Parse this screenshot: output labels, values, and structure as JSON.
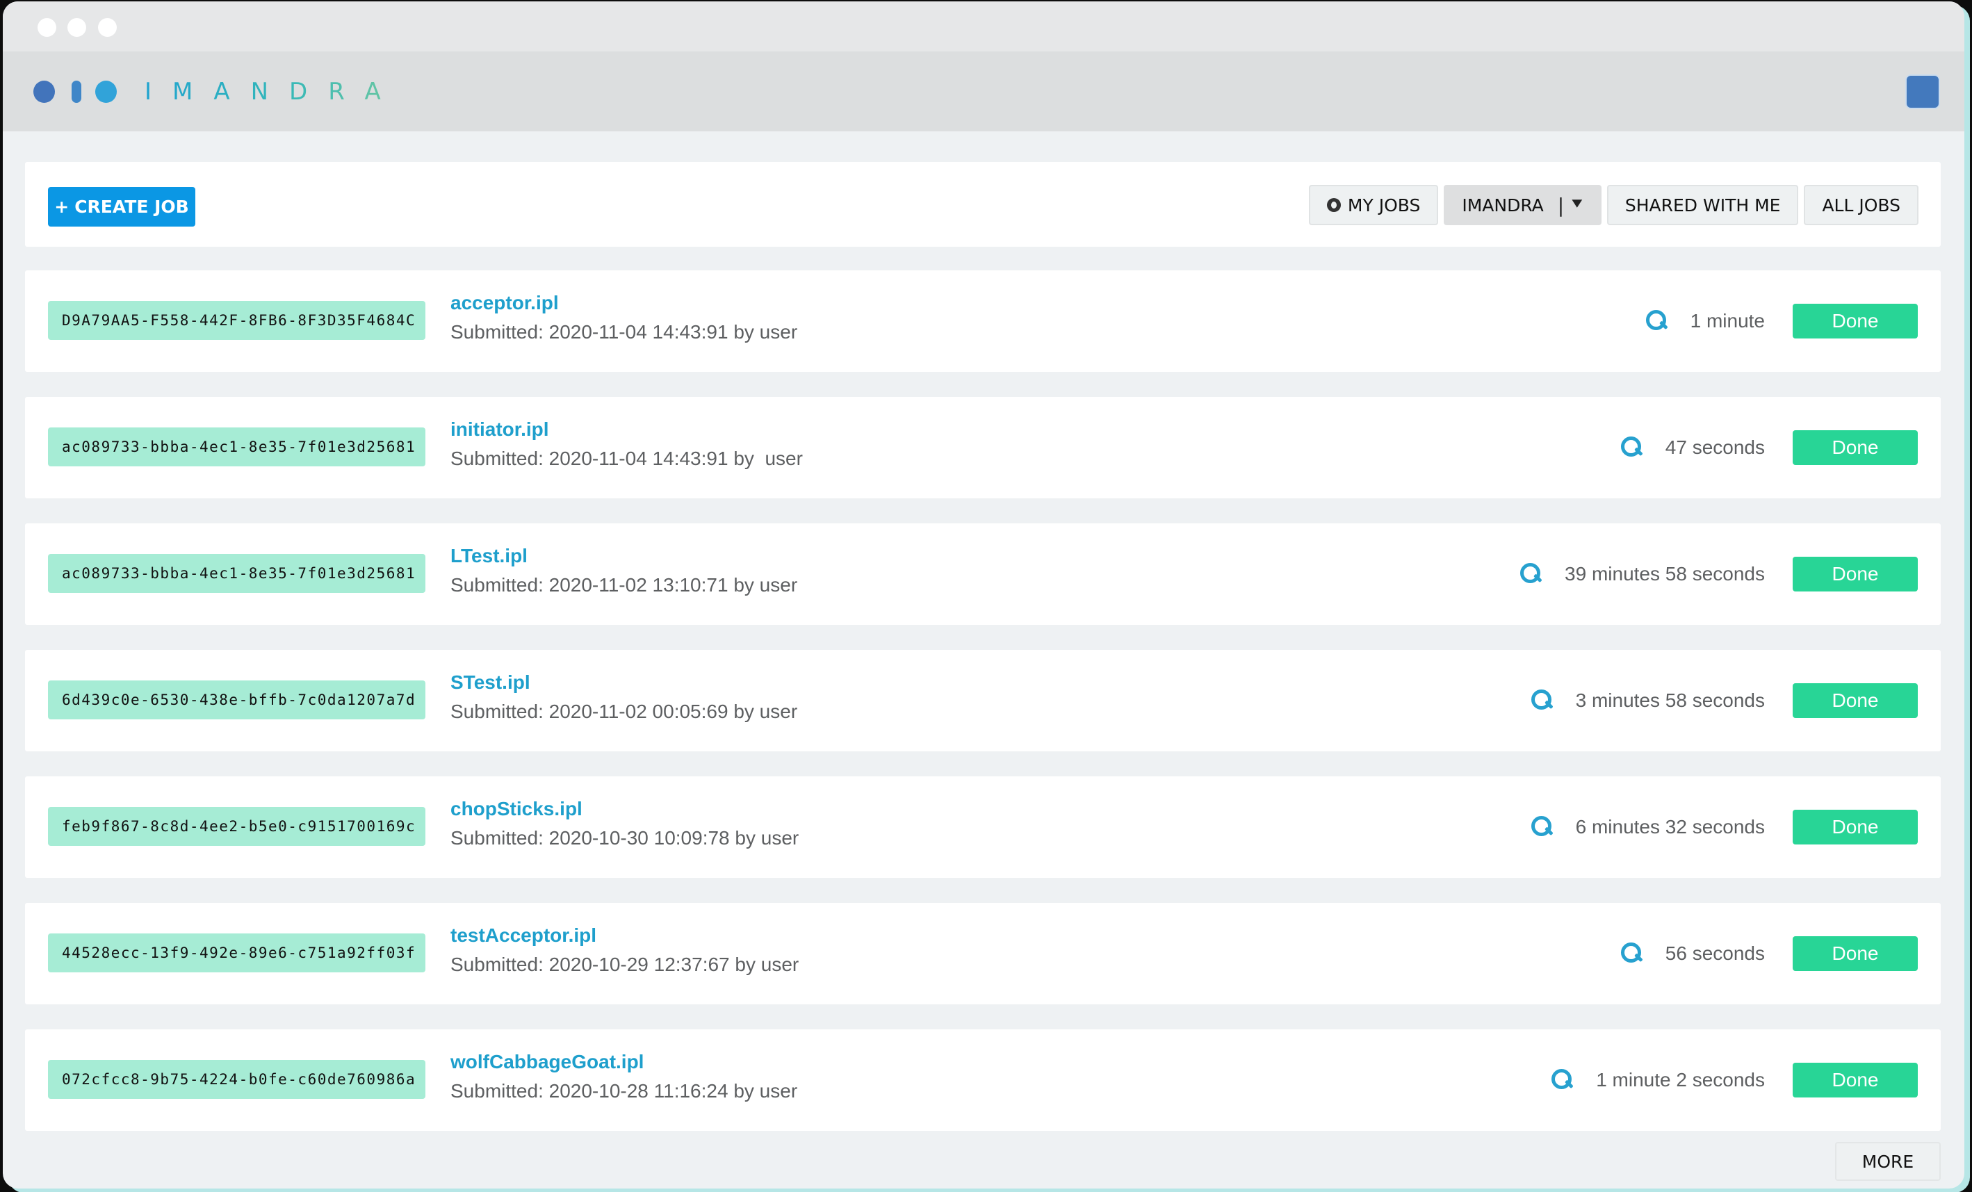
{
  "window": {
    "controls": [
      "close",
      "minimize",
      "maximize"
    ]
  },
  "app": {
    "brand": "IMANDRA",
    "user_avatar_color": "#4379bd"
  },
  "toolbar": {
    "create_job_icon": "+",
    "create_job_label": "CREATE JOB",
    "filters": {
      "my_jobs": {
        "icon": "eye-icon",
        "label": "MY JOBS"
      },
      "org": {
        "label": "IMANDRA",
        "separator": "|",
        "icon": "double-chevron-down-icon",
        "glyph": "»"
      },
      "shared": {
        "label": "SHARED WITH ME"
      },
      "all": {
        "label": "ALL JOBS"
      }
    }
  },
  "colors": {
    "accent": "#0b97e4",
    "link": "#1e9fcc",
    "done": "#28d596",
    "id_badge": "#a6ecd5"
  },
  "jobs": [
    {
      "id": "D9A79AA5-F558-442F-8FB6-8F3D35F4684C",
      "name": "acceptor.ipl",
      "submitted": "Submitted: 2020-11-04 14:43:91 by user",
      "duration": "1 minute",
      "status": "Done"
    },
    {
      "id": "ac089733-bbba-4ec1-8e35-7f01e3d25681",
      "name": "initiator.ipl",
      "submitted": "Submitted: 2020-11-04 14:43:91 by  user",
      "duration": "47 seconds",
      "status": "Done"
    },
    {
      "id": "ac089733-bbba-4ec1-8e35-7f01e3d25681",
      "name": "LTest.ipl",
      "submitted": "Submitted: 2020-11-02 13:10:71 by user",
      "duration": "39 minutes 58 seconds",
      "status": "Done"
    },
    {
      "id": "6d439c0e-6530-438e-bffb-7c0da1207a7d",
      "name": "STest.ipl",
      "submitted": "Submitted: 2020-11-02 00:05:69 by user",
      "duration": "3 minutes 58 seconds",
      "status": "Done"
    },
    {
      "id": "feb9f867-8c8d-4ee2-b5e0-c9151700169c",
      "name": "chopSticks.ipl",
      "submitted": "Submitted: 2020-10-30 10:09:78 by user",
      "duration": "6 minutes 32 seconds",
      "status": "Done"
    },
    {
      "id": "44528ecc-13f9-492e-89e6-c751a92ff03f",
      "name": "testAcceptor.ipl",
      "submitted": "Submitted: 2020-10-29 12:37:67 by user",
      "duration": "56 seconds",
      "status": "Done"
    },
    {
      "id": "072cfcc8-9b75-4224-b0fe-c60de760986a",
      "name": "wolfCabbageGoat.ipl",
      "submitted": "Submitted: 2020-10-28 11:16:24 by user",
      "duration": "1 minute 2 seconds",
      "status": "Done"
    }
  ],
  "pagination": {
    "more_label": "MORE"
  }
}
